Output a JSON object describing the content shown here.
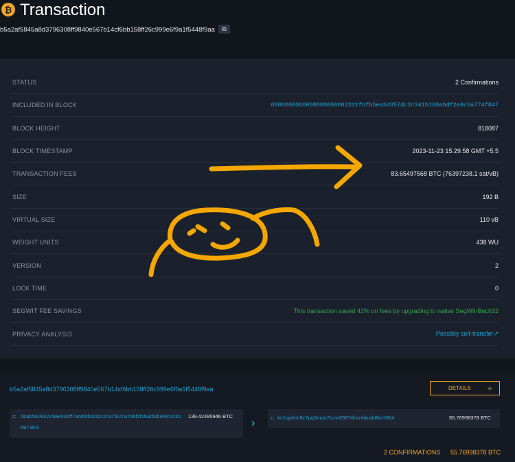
{
  "header": {
    "logo_glyph": "₿",
    "title": "Transaction",
    "txid": "b5a2af5845a8d3796308ff9840e567b14cf6bb158ff26c999e6f9a1f5448f9aa",
    "copy_glyph": "⧉"
  },
  "details": {
    "rows": [
      {
        "label": "STATUS",
        "value": "2 Confirmations"
      },
      {
        "label": "INCLUDED IN BLOCK",
        "value": "00000000000000000000022d1fbfb5ea34357dc2c341b160abdf2e8c5a774f847"
      },
      {
        "label": "BLOCK HEIGHT",
        "value": "818087"
      },
      {
        "label": "BLOCK TIMESTAMP",
        "value": "2023-11-23 15:29:58 GMT +5.5"
      },
      {
        "label": "TRANSACTION FEES",
        "value": "83.65497568 BTC (76397238.1 sat/vB)"
      },
      {
        "label": "SIZE",
        "value": "192 B"
      },
      {
        "label": "VIRTUAL SIZE",
        "value": "110 vB"
      },
      {
        "label": "WEIGHT UNITS",
        "value": "438 WU"
      },
      {
        "label": "VERSION",
        "value": "2"
      },
      {
        "label": "LOCK TIME",
        "value": "0"
      },
      {
        "label": "SEGWIT FEE SAVINGS",
        "value": "This transaction saved 42% on fees by upgrading to native SegWit-Bech32"
      },
      {
        "label": "PRIVACY ANALYSIS",
        "value": "Possibly self-transfer↗"
      }
    ]
  },
  "flow": {
    "txid": "b5a2af5845a8d3796308ff9840e567b14cf6bb158ff26c999e6f9a1f5448f9aa",
    "details_label": "DETAILS",
    "details_plus": "+",
    "input": {
      "prefix": "⊏",
      "address_line1": "5bab56063279ae031ff7acd0d201bc2c37f627a76bf2f1b3cbd0e8c141b",
      "address_line2": "d9739:0",
      "amount": "139.42495946 BTC"
    },
    "arrow": "›",
    "output": {
      "prefix": "⊏",
      "address": "bc1qyfem6z7pq3mqn7tcnn0587dhcnhkrqh8km36t4",
      "amount": "55.76998378 BTC"
    },
    "confirmations": "2 CONFIRMATIONS",
    "total": "55.76998378 BTC"
  },
  "colors": {
    "accent_orange": "#f7a623",
    "link_blue": "#1ba3d9",
    "success_green": "#2fa74a",
    "scribble": "#f5a700"
  }
}
